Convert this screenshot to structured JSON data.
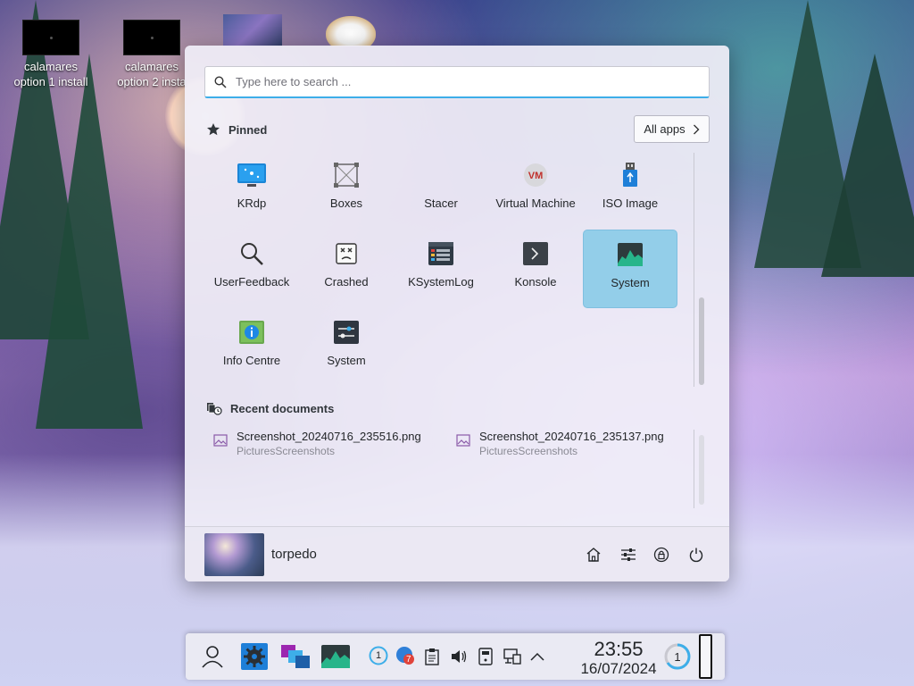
{
  "desktop": {
    "icons": [
      {
        "label_line1": "calamares",
        "label_line2": "option 1 install"
      },
      {
        "label_line1": "calamares",
        "label_line2": "option 2 insta"
      }
    ]
  },
  "launcher": {
    "search": {
      "placeholder": "Type here to search ...",
      "value": ""
    },
    "pinned_label": "Pinned",
    "all_apps_label": "All apps",
    "pinned": [
      {
        "label": "KRdp",
        "icon": "krdp-icon"
      },
      {
        "label": "Boxes",
        "icon": "boxes-icon"
      },
      {
        "label": "Stacer",
        "icon": "stacer-icon"
      },
      {
        "label": "Virtual Machine",
        "icon": "virtual-machine-icon"
      },
      {
        "label": "ISO Image",
        "icon": "iso-image-icon"
      },
      {
        "label": "UserFeedback",
        "icon": "magnifier-icon"
      },
      {
        "label": "Crashed",
        "icon": "crashed-icon"
      },
      {
        "label": "KSystemLog",
        "icon": "ksystemlog-icon"
      },
      {
        "label": "Konsole",
        "icon": "konsole-icon"
      },
      {
        "label": "System",
        "icon": "system-monitor-icon",
        "selected": true
      },
      {
        "label": "Info Centre",
        "icon": "info-centre-icon"
      },
      {
        "label": "System",
        "icon": "system-settings-icon"
      }
    ],
    "recent_label": "Recent documents",
    "recent": [
      {
        "name": "Screenshot_20240716_235516.png",
        "path": "PicturesScreenshots"
      },
      {
        "name": "Screenshot_20240716_235137.png",
        "path": "PicturesScreenshots"
      }
    ],
    "user": {
      "name": "torpedo"
    },
    "footer_buttons": [
      "home-icon",
      "settings-sliders-icon",
      "lock-icon",
      "power-icon"
    ]
  },
  "taskbar": {
    "clock": {
      "time": "23:55",
      "date": "16/07/2024"
    },
    "badges": {
      "updates": "1",
      "notifications": "7",
      "tasks": "1"
    }
  },
  "colors": {
    "accent": "#3daee9",
    "selected_tile": "#93cee9"
  }
}
